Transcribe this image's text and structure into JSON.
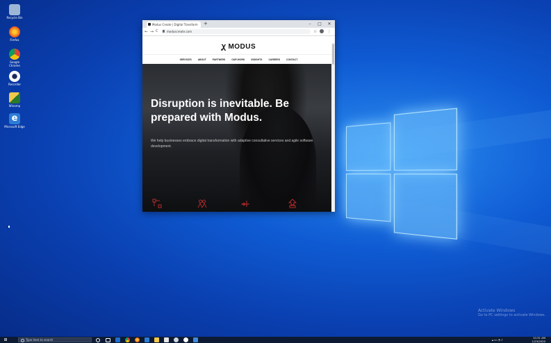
{
  "desktop": {
    "icons": [
      {
        "label": "Recycle Bin",
        "color": "#9db6d6"
      },
      {
        "label": "Firefox",
        "color": "#e8531f"
      },
      {
        "label": "Google Chrome",
        "color": "#f4c20d"
      },
      {
        "label": "Recorder",
        "color": "#ffffff"
      },
      {
        "label": "Winamp",
        "color": "#2b7a2b"
      },
      {
        "label": "Microsoft Edge",
        "color": "#2d7cd6"
      }
    ]
  },
  "browser": {
    "tab_title": "Modus Create | Digital Transform",
    "new_tab": "+",
    "win_min": "–",
    "win_max": "□",
    "win_close": "✕",
    "back": "←",
    "forward": "→",
    "reload": "C",
    "url": "moduscreate.com",
    "star": "☆"
  },
  "site": {
    "logo_text": "MODUS",
    "nav": [
      "SERVICES",
      "ABOUT",
      "PARTNERS",
      "OUR WORK",
      "INSIGHTS",
      "CAREERS",
      "CONTACT"
    ],
    "headline": "Disruption is inevitable. Be prepared with Modus.",
    "subtext": "We help businesses embrace digital transformation with adaptive consultative services and agile software development.",
    "accent_color": "#e03131"
  },
  "watermark": {
    "title": "Activate Windows",
    "subtitle": "Go to PC settings to activate Windows."
  },
  "taskbar": {
    "search_placeholder": "Type here to search",
    "time": "10:31 AM",
    "date": "1/23/2020"
  }
}
